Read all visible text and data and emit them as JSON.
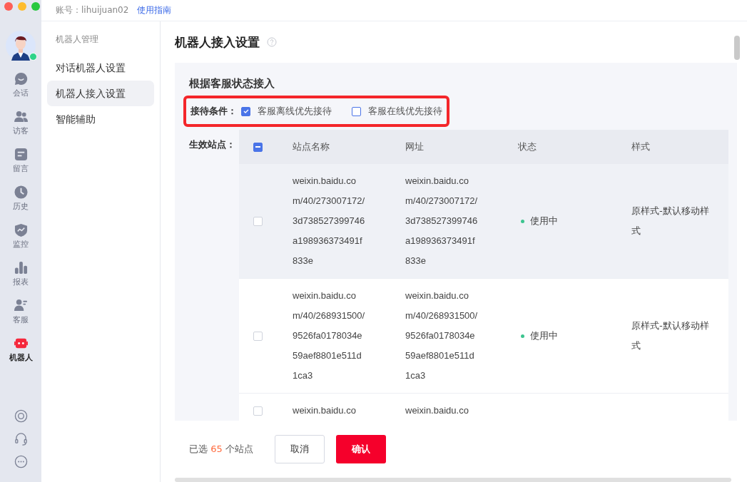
{
  "top_bar": {
    "account_label": "账号：lihuijuan02",
    "guide_link": "使用指南"
  },
  "rail": {
    "user_online": true,
    "items": [
      {
        "kind": "chat",
        "label": "会话",
        "selected": false
      },
      {
        "kind": "visitors",
        "label": "访客",
        "selected": false
      },
      {
        "kind": "note",
        "label": "留言",
        "selected": false
      },
      {
        "kind": "clock",
        "label": "历史",
        "selected": false
      },
      {
        "kind": "shield",
        "label": "监控",
        "selected": false
      },
      {
        "kind": "bars",
        "label": "报表",
        "selected": false
      },
      {
        "kind": "agent",
        "label": "客服",
        "selected": false
      },
      {
        "kind": "robot",
        "label": "机器人",
        "selected": true
      }
    ],
    "bottom_icons": [
      {
        "kind": "settings"
      },
      {
        "kind": "headset"
      },
      {
        "kind": "more"
      }
    ]
  },
  "sub_nav": {
    "heading": "机器人管理",
    "items": [
      {
        "label": "对话机器人设置",
        "selected": false
      },
      {
        "label": "机器人接入设置",
        "selected": true
      },
      {
        "label": "智能辅助",
        "selected": false
      }
    ]
  },
  "page": {
    "title": "机器人接入设置",
    "section_title": "根据客服状态接入",
    "conditions": {
      "label": "接待条件：",
      "highlighted": true,
      "options": [
        {
          "label": "客服离线优先接待",
          "checked": true
        },
        {
          "label": "客服在线优先接待",
          "checked": false
        }
      ]
    },
    "sites_label": "生效站点：",
    "table": {
      "header_indeterminate": true,
      "columns": [
        "站点名称",
        "网址",
        "状态",
        "样式"
      ],
      "rows": [
        {
          "checked": false,
          "hovered": true,
          "name": "weixin.baidu.com/40/273007172/3d738527399746a198936373491f833e",
          "url": "weixin.baidu.com/40/273007172/3d738527399746a198936373491f833e",
          "status": "使用中",
          "style": "原样式-默认移动样式"
        },
        {
          "checked": false,
          "hovered": false,
          "name": "weixin.baidu.com/40/268931500/9526fa0178034e59aef8801e511d1ca3",
          "url": "weixin.baidu.com/40/268931500/9526fa0178034e59aef8801e511d1ca3",
          "status": "使用中",
          "style": "原样式-默认移动样式"
        },
        {
          "checked": false,
          "hovered": false,
          "name": "weixin.baidu.co",
          "url": "weixin.baidu.co"
        }
      ]
    }
  },
  "footer": {
    "selected_prefix": "已选",
    "selected_count": "65",
    "selected_suffix": "个站点",
    "cancel": "取消",
    "confirm": "确认"
  }
}
